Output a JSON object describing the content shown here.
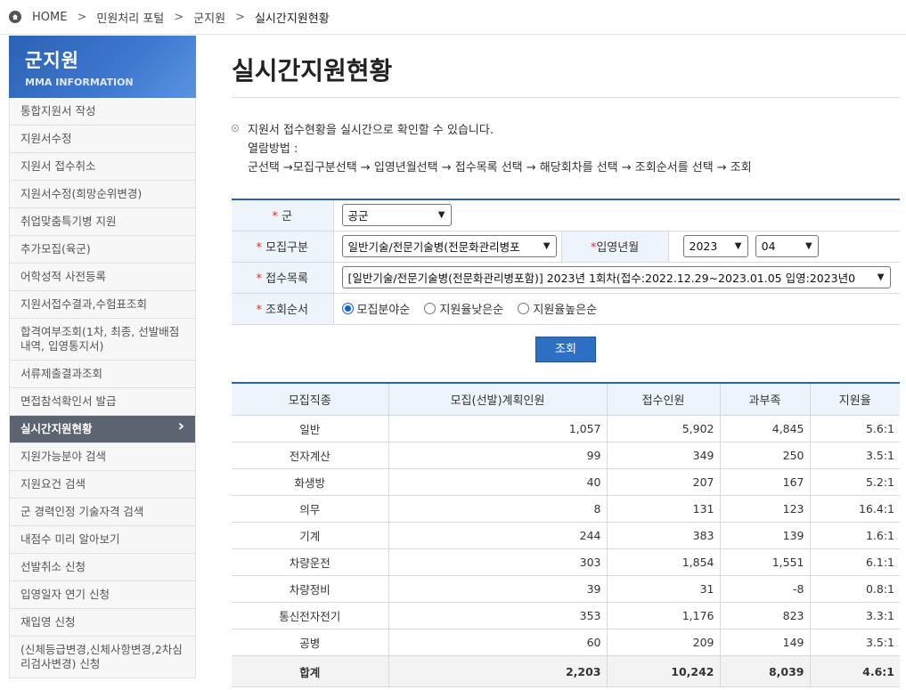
{
  "breadcrumb": {
    "home": "HOME",
    "items": [
      "민원처리 포털",
      "군지원"
    ],
    "current": "실시간지원현황"
  },
  "sidebar": {
    "title": "군지원",
    "subtitle": "MMA INFORMATION",
    "items": [
      "통합지원서 작성",
      "지원서수정",
      "지원서 접수취소",
      "지원서수정(희망순위변경)",
      "취업맞춤특기병 지원",
      "추가모집(육군)",
      "어학성적 사전등록",
      "지원서접수결과,수험표조회",
      "합격여부조회(1차, 최종, 선발배점내역, 입영통지서)",
      "서류제출결과조회",
      "면접참석확인서 발급",
      "실시간지원현황",
      "지원가능분야 검색",
      "지원요건 검색",
      "군 경력인정 기술자격 검색",
      "내점수 미리 알아보기",
      "선발취소 신청",
      "입영일자 연기 신청",
      "재입영 신청",
      "(신체등급변경,신체사항변경,2차심리검사변경) 신청"
    ]
  },
  "page": {
    "title": "실시간지원현황",
    "desc1": "지원서 접수현황을 실시간으로 확인할 수 있습니다.",
    "desc2": "열람방법 :",
    "desc3": "군선택 →모집구분선택 → 입영년월선택 → 접수목록 선택 → 해당회차를 선택 → 조회순서를 선택 → 조회"
  },
  "form": {
    "req_mark": "*",
    "branch_label": "군",
    "branch_value": "공군",
    "category_label": "모집구분",
    "category_value": "일반기술/전문기술병(전문화관리병포",
    "enlist_label": "입영년월",
    "year_value": "2023",
    "month_value": "04",
    "list_label": "접수목록",
    "list_value": "[일반기술/전문기술병(전문화관리병포함)] 2023년 1회차(접수:2022.12.29~2023.01.05 입영:2023년0",
    "order_label": "조회순서",
    "orders": [
      "모집분야순",
      "지원율낮은순",
      "지원율높은순"
    ],
    "selected_order": 0,
    "submit": "조회"
  },
  "table": {
    "headers": [
      "모집직종",
      "모집(선발)계획인원",
      "접수인원",
      "과부족",
      "지원율"
    ],
    "rows": [
      [
        "일반",
        "1,057",
        "5,902",
        "4,845",
        "5.6:1"
      ],
      [
        "전자계산",
        "99",
        "349",
        "250",
        "3.5:1"
      ],
      [
        "화생방",
        "40",
        "207",
        "167",
        "5.2:1"
      ],
      [
        "의무",
        "8",
        "131",
        "123",
        "16.4:1"
      ],
      [
        "기계",
        "244",
        "383",
        "139",
        "1.6:1"
      ],
      [
        "차량운전",
        "303",
        "1,854",
        "1,551",
        "6.1:1"
      ],
      [
        "차량정비",
        "39",
        "31",
        "-8",
        "0.8:1"
      ],
      [
        "통신전자전기",
        "353",
        "1,176",
        "823",
        "3.3:1"
      ],
      [
        "공병",
        "60",
        "209",
        "149",
        "3.5:1"
      ]
    ],
    "total": [
      "합계",
      "2,203",
      "10,242",
      "8,039",
      "4.6:1"
    ]
  },
  "colors": {
    "accent": "#2c61b4",
    "negative": "#e0322b",
    "active_menu": "#5b6470"
  }
}
